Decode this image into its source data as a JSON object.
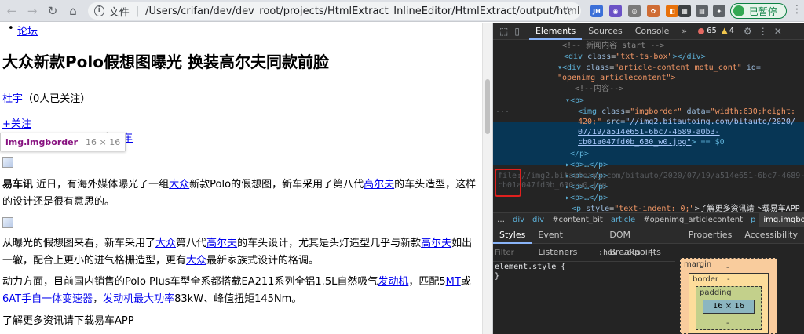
{
  "browser": {
    "nav": {
      "back": "←",
      "forward": "→",
      "reload": "↻",
      "home": "⌂"
    },
    "omnibox": {
      "scheme_label": "文件",
      "separator": "|",
      "url": "/Users/crifan/dev/dev_root/projects/HtmlExtract_InlineEditor/HtmlExtract/output/html_202007..."
    },
    "star": "☆",
    "extensions": [
      {
        "label": "JH",
        "color": "#3b6fd8"
      },
      {
        "label": "◉",
        "color": "#6b52c6"
      },
      {
        "label": "◎",
        "color": "#7a7a7a"
      },
      {
        "label": "✿",
        "color": "#cf6c34"
      },
      {
        "label": "◧",
        "color": "#e8710a"
      },
      {
        "label": "▦",
        "color": "#3c4043"
      },
      {
        "label": "▤",
        "color": "#5f6368"
      },
      {
        "label": "✦",
        "color": "#5f6368"
      }
    ],
    "profile_label": "已暂停",
    "menu": "⋮"
  },
  "page": {
    "forum_link": "论坛",
    "headline": "大众新款Polo假想图曝光 换装高尔夫同款前脸",
    "author_link": "杜宇",
    "author_followers": "（0人已关注）",
    "follow_link": "+关注",
    "source_prefix": "自",
    "source_link": "易车",
    "tooltip": {
      "tag": "img.imgborder",
      "size": "16 × 16"
    },
    "para1": {
      "lead": "易车讯",
      "t1": " 近日，有海外媒体曝光了一组",
      "l1": "大众",
      "t2": "新款Polo的假想图，新车采用了第八代",
      "l2": "高尔夫",
      "t3": "的车头造型，这样的设计还是很有意思的。"
    },
    "para2": {
      "t1": "从曝光的假想图来看，新车采用了",
      "l1": "大众",
      "t2": "第八代",
      "l2": "高尔夫",
      "t3": "的车头设计，尤其是头灯造型几乎与新款",
      "l3": "高尔夫",
      "t4": "如出一辙，配合上更小的进气格栅造型，更有",
      "l4": "大众",
      "t5": "最新家族式设计的格调。"
    },
    "para3": {
      "t1": "动力方面，目前国内销售的Polo Plus车型全系都搭载EA211系列全铝1.5L自然吸气",
      "l1": "发动机",
      "t2": "，匹配5",
      "l2": "MT",
      "t3": "或",
      "l3": "6AT手自一体变速器",
      "t4": "，",
      "l4": "发动机最大功率",
      "t5": "83kW、峰值扭矩145Nm。"
    },
    "para4": "了解更多资讯请下载易车APP"
  },
  "devtools": {
    "tabs": [
      "Elements",
      "Sources",
      "Console",
      "»"
    ],
    "errors": "65",
    "warnings": "4",
    "dom": {
      "l1": "<!-- 新闻内容 start -->",
      "l2_tag_open": "<div ",
      "l2_attr": "class",
      "l2_val": "\"txt-ts-box\"",
      "l2_tag_close": "></div>",
      "l3_tag_open": "▾<div ",
      "l3_attr": "class",
      "l3_val": "\"article-content motu_cont\"",
      "l3_attr2": " id=",
      "l3b_val": "\"openimg_articlecontent\">",
      "l4": "<!--内容-->",
      "l5": "▾<p>",
      "sel1_tag": "<img ",
      "sel1_attr": "class",
      "sel1_val": "\"imgborder\"",
      "sel1_attr2": " data=",
      "sel1_val2": "\"width:630;height:",
      "sel2_val": "420;\"",
      "sel2_attr": " src=",
      "sel2_link": "\"//img2.bitautoimg.com/bitauto/2020/",
      "sel3_link": "07/19/a514e651-6bc7-4689-a0b3-",
      "sel4_link": "cb01a047fd0b_630_w0.jpg\"",
      "sel4_tail": "> == $0",
      "l_close_p": "</p>",
      "p1": "▸<p>…</p>",
      "p2": "▸<p>…</p>",
      "p3": "▸<p>…</p>",
      "p4": "▸<p>…</p>",
      "last_tag": "<p ",
      "last_attr": "style",
      "last_val": "\"text-indent: 0;\"",
      "last_text": ">了解更多资讯请下载易车APP",
      "ghost1": "file://img2.bitautoimg.com/bitauto/2020/07/19/a514e651-6bc7-4689-a0b3-",
      "ghost2": "cb01a047fd0b_630_w0.jpg"
    },
    "breadcrumbs": [
      "…",
      "div",
      "div",
      "#content_bit",
      "article",
      "#openimg_articlecontent",
      "p",
      "img.imgborder"
    ],
    "subtabs": [
      "Styles",
      "Event Listeners",
      "DOM Breakpoints",
      "Properties",
      "Accessibility"
    ],
    "filter_placeholder": "Filter",
    "hov": ":hov",
    "cls": ".cls",
    "plus": "+",
    "element_style": "element.style {",
    "element_style_close": "}",
    "box_model": {
      "margin": "margin",
      "margin_val": "-",
      "border": "border",
      "border_val": "-",
      "padding": "padding",
      "padding_val": "-",
      "content": "16 × 16"
    }
  }
}
